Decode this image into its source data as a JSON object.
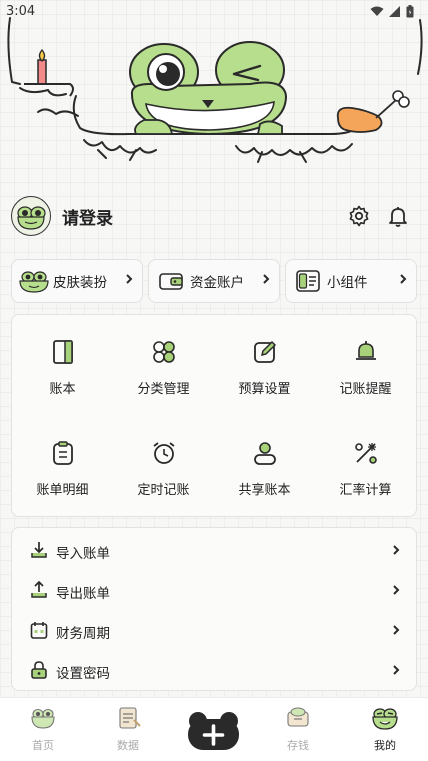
{
  "status_bar": {
    "time": "3:04"
  },
  "profile": {
    "login_label": "请登录"
  },
  "quick_cards": [
    {
      "label": "皮肤装扮",
      "icon": "frog-face-icon"
    },
    {
      "label": "资金账户",
      "icon": "wallet-icon"
    },
    {
      "label": "小组件",
      "icon": "widget-icon"
    }
  ],
  "grid_items": [
    {
      "label": "账本",
      "icon": "book-icon"
    },
    {
      "label": "分类管理",
      "icon": "category-clover-icon"
    },
    {
      "label": "预算设置",
      "icon": "edit-square-icon"
    },
    {
      "label": "记账提醒",
      "icon": "bell-reminder-icon"
    },
    {
      "label": "账单明细",
      "icon": "clipboard-list-icon"
    },
    {
      "label": "定时记账",
      "icon": "alarm-clock-icon"
    },
    {
      "label": "共享账本",
      "icon": "user-share-icon"
    },
    {
      "label": "汇率计算",
      "icon": "exchange-rate-icon"
    }
  ],
  "list_items": [
    {
      "label": "导入账单",
      "icon": "import-icon"
    },
    {
      "label": "导出账单",
      "icon": "export-icon"
    },
    {
      "label": "财务周期",
      "icon": "calendar-icon"
    },
    {
      "label": "设置密码",
      "icon": "lock-icon"
    }
  ],
  "tabs": [
    {
      "label": "首页",
      "icon": "frog-home-icon"
    },
    {
      "label": "数据",
      "icon": "frog-data-icon"
    },
    {
      "label": "存钱",
      "icon": "frog-savings-icon"
    },
    {
      "label": "我的",
      "icon": "frog-mine-icon"
    }
  ],
  "active_tab": "我的",
  "colors": {
    "accent_green": "#a8d27a",
    "dark": "#2a2a2a",
    "drumstick": "#f5a55a"
  }
}
